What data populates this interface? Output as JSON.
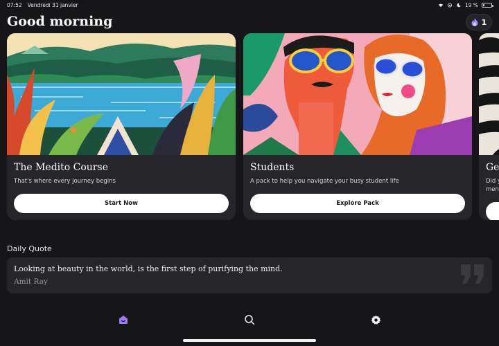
{
  "status_bar": {
    "time": "07:52",
    "date": "Vendredi 31 janvier",
    "battery": "19 %",
    "battery_level": 0.19
  },
  "header": {
    "greeting": "Good morning",
    "streak_count": "1",
    "streak_icon": "flame-icon"
  },
  "cards": [
    {
      "title": "The Medito Course",
      "subtitle": "That's where every journey begins",
      "button": "Start Now",
      "art": "tropical-lake-painting"
    },
    {
      "title": "Students",
      "subtitle": "A pack to help you navigate your busy student life",
      "button": "Explore Pack",
      "art": "two-faces-sunglasses-painting"
    },
    {
      "title": "Ge",
      "subtitle_line1": "Did y",
      "subtitle_line2": "ment"
    }
  ],
  "daily_quote": {
    "label": "Daily Quote",
    "text": "Looking at beauty in the world, is the first step of purifying the mind.",
    "author": "Amit Ray"
  },
  "nav": {
    "items": [
      "home-icon",
      "search-icon",
      "settings-icon"
    ],
    "active_color": "#9b7cf0"
  }
}
